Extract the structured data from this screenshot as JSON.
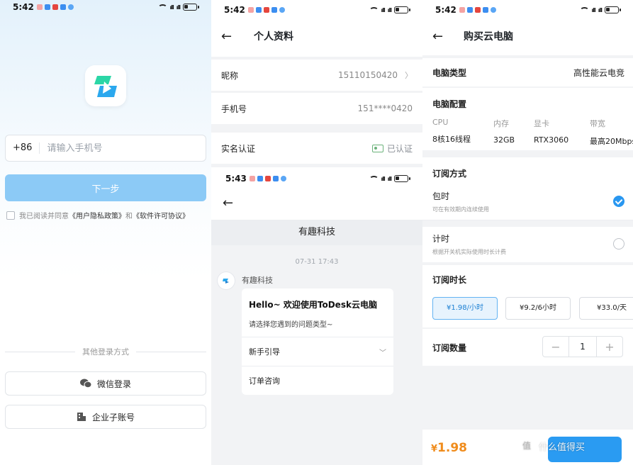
{
  "colors": {
    "accent": "#2a9bf2",
    "price": "#f08c1c",
    "verified": "#6bb27a",
    "button_disabled": "#8ccaf6"
  },
  "login": {
    "status_time": "5:42",
    "country_code": "+86",
    "phone_placeholder": "请输入手机号",
    "next_label": "下一步",
    "agreement_prefix": "我已阅读并同意",
    "privacy_link": "《用户隐私政策》",
    "and": "和",
    "license_link": "《软件许可协议》",
    "other_login": "其他登录方式",
    "wechat_login": "微信登录",
    "enterprise_login": "企业子账号"
  },
  "profile": {
    "status_time": "5:42",
    "title": "个人资料",
    "nickname_label": "昵称",
    "nickname_value": "15110150420",
    "phone_label": "手机号",
    "phone_value": "151****0420",
    "realname_label": "实名认证",
    "realname_value": "已认证"
  },
  "chat": {
    "status_time": "5:43",
    "title": "有趣科技",
    "timestamp": "07-31 17:43",
    "bot_name": "有趣科技",
    "greeting": "Hello~ 欢迎使用ToDesk云电脑",
    "prompt": "请选择您遇到的问题类型~",
    "options": [
      "新手引导",
      "订单咨询"
    ]
  },
  "purchase": {
    "status_time": "5:42",
    "title": "购买云电脑",
    "type_label": "电脑类型",
    "type_value": "高性能云电竞",
    "config_label": "电脑配置",
    "specs": [
      {
        "key": "CPU",
        "value": "8核16线程"
      },
      {
        "key": "内存",
        "value": "32GB"
      },
      {
        "key": "显卡",
        "value": "RTX3060"
      },
      {
        "key": "带宽",
        "value": "最高20Mbps"
      }
    ],
    "sub_mode_label": "订阅方式",
    "modes": [
      {
        "title": "包时",
        "desc": "可在有效期内连续使用",
        "selected": true
      },
      {
        "title": "计时",
        "desc": "根据开关机实际使用时长计费",
        "selected": false
      }
    ],
    "duration_label": "订阅时长",
    "plans": [
      "¥1.98/小时",
      "¥9.2/6小时",
      "¥33.0/天"
    ],
    "quantity_label": "订阅数量",
    "quantity": "1",
    "minus": "−",
    "plus": "+",
    "currency": "¥",
    "total": "1.98"
  },
  "watermark": {
    "text": "什么值得买",
    "mark": "值"
  }
}
